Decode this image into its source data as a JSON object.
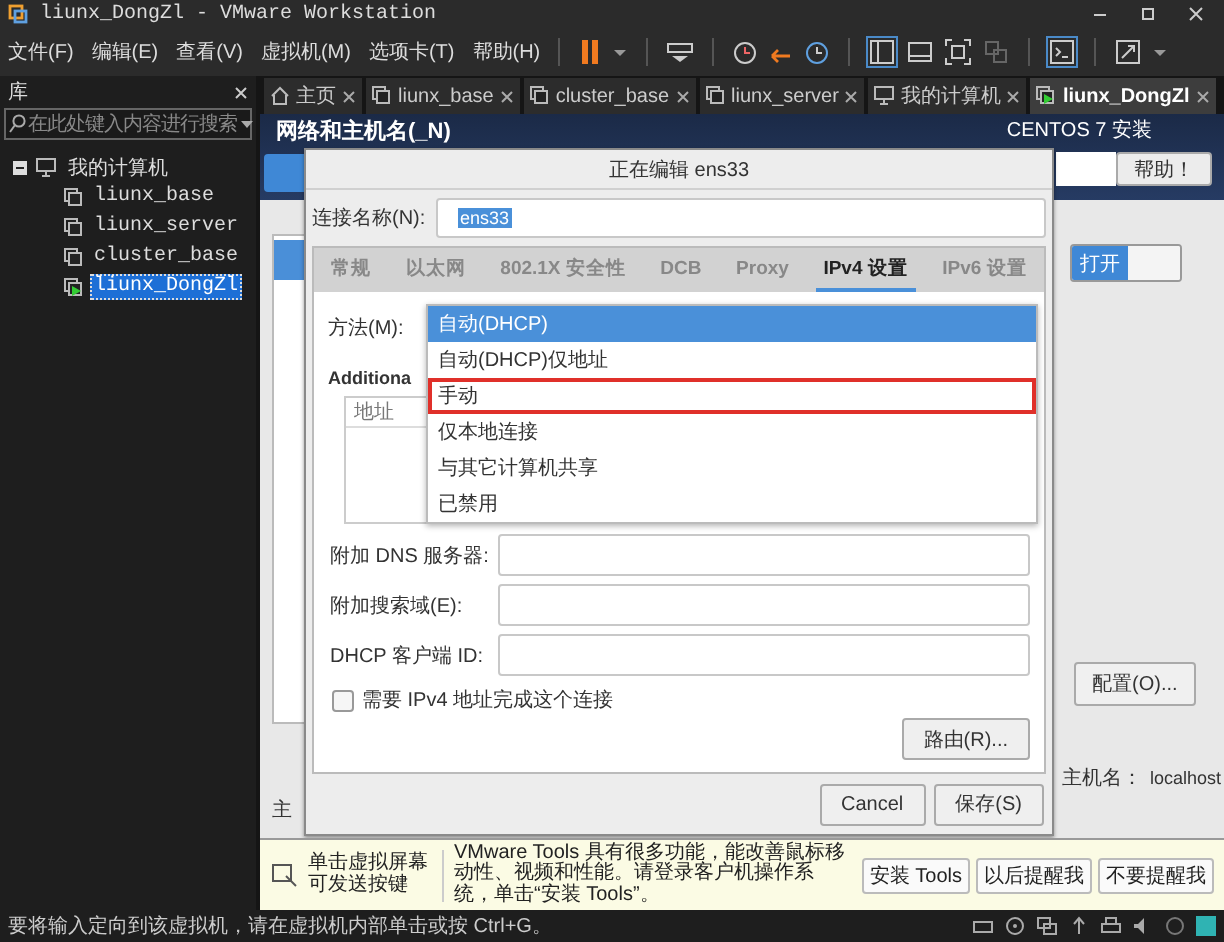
{
  "window": {
    "title": "liunx_DongZl - VMware Workstation"
  },
  "menu": [
    "文件(F)",
    "编辑(E)",
    "查看(V)",
    "虚拟机(M)",
    "选项卡(T)",
    "帮助(H)"
  ],
  "library": {
    "title": "库",
    "search": {
      "placeholder": "在此处键入内容进行搜索"
    },
    "tree": [
      {
        "label": "我的计算机",
        "expanded": true,
        "children": [
          {
            "label": "liunx_base",
            "selected": false,
            "running": false
          },
          {
            "label": "liunx_server",
            "selected": false,
            "running": false
          },
          {
            "label": "cluster_base",
            "selected": false,
            "running": false
          },
          {
            "label": "liunx_DongZl",
            "selected": true,
            "running": true
          }
        ]
      }
    ]
  },
  "tabs": [
    {
      "label": "主页",
      "kind": "home",
      "selected": false
    },
    {
      "label": "liunx_base",
      "kind": "vm",
      "selected": false
    },
    {
      "label": "cluster_base",
      "kind": "vm",
      "selected": false
    },
    {
      "label": "liunx_server",
      "kind": "vm",
      "selected": false
    },
    {
      "label": "我的计算机",
      "kind": "host",
      "selected": false
    },
    {
      "label": "liunx_DongZl",
      "kind": "vm_running",
      "selected": true
    }
  ],
  "installer": {
    "section_title": "网络和主机名(_N)",
    "product_title": "CENTOS 7 安装",
    "help_button": "帮助！",
    "host_label_cut": "主",
    "switch": {
      "label": "打开",
      "on": true
    },
    "configure_button": "配置(O)...",
    "hostname_label": "主机名：",
    "hostname_value": "localhost"
  },
  "dialog": {
    "title": "正在编辑 ens33",
    "name_label": "连接名称(N):",
    "name_value": "ens33",
    "tabs": [
      {
        "label": "常规",
        "selected": false
      },
      {
        "label": "以太网",
        "selected": false
      },
      {
        "label": "802.1X 安全性",
        "selected": false
      },
      {
        "label": "DCB",
        "selected": false
      },
      {
        "label": "Proxy",
        "selected": false
      },
      {
        "label": "IPv4 设置",
        "selected": true
      },
      {
        "label": "IPv6 设置",
        "selected": false
      }
    ],
    "method_label": "方法(M):",
    "method_options": [
      {
        "label": "自动(DHCP)",
        "selected": true,
        "marked": false
      },
      {
        "label": "自动(DHCP)仅地址",
        "selected": false,
        "marked": false
      },
      {
        "label": "手动",
        "selected": false,
        "marked": true
      },
      {
        "label": "仅本地连接",
        "selected": false,
        "marked": false
      },
      {
        "label": "与其它计算机共享",
        "selected": false,
        "marked": false
      },
      {
        "label": "已禁用",
        "selected": false,
        "marked": false
      }
    ],
    "additional_label": "Additiona",
    "address_header": "地址",
    "fields": [
      {
        "label": "附加 DNS 服务器:"
      },
      {
        "label": "附加搜索域(E):"
      },
      {
        "label": "DHCP 客户端 ID:"
      }
    ],
    "require_checkbox": {
      "label": "需要 IPv4 地址完成这个连接",
      "checked": false
    },
    "routes_button": "路由(R)...",
    "buttons": [
      "Cancel",
      "保存(S)"
    ]
  },
  "notification": {
    "hint": "单击虚拟屏幕可发送按键",
    "message": "VMware Tools 具有很多功能，能改善鼠标移动性、视频和性能。请登录客户机操作系统，单击“安装 Tools”。",
    "buttons": [
      "安装 Tools",
      "以后提醒我",
      "不要提醒我"
    ]
  },
  "status_bar": {
    "text": "要将输入定向到该虚拟机，请在虚拟机内部单击或按 Ctrl+G。"
  }
}
